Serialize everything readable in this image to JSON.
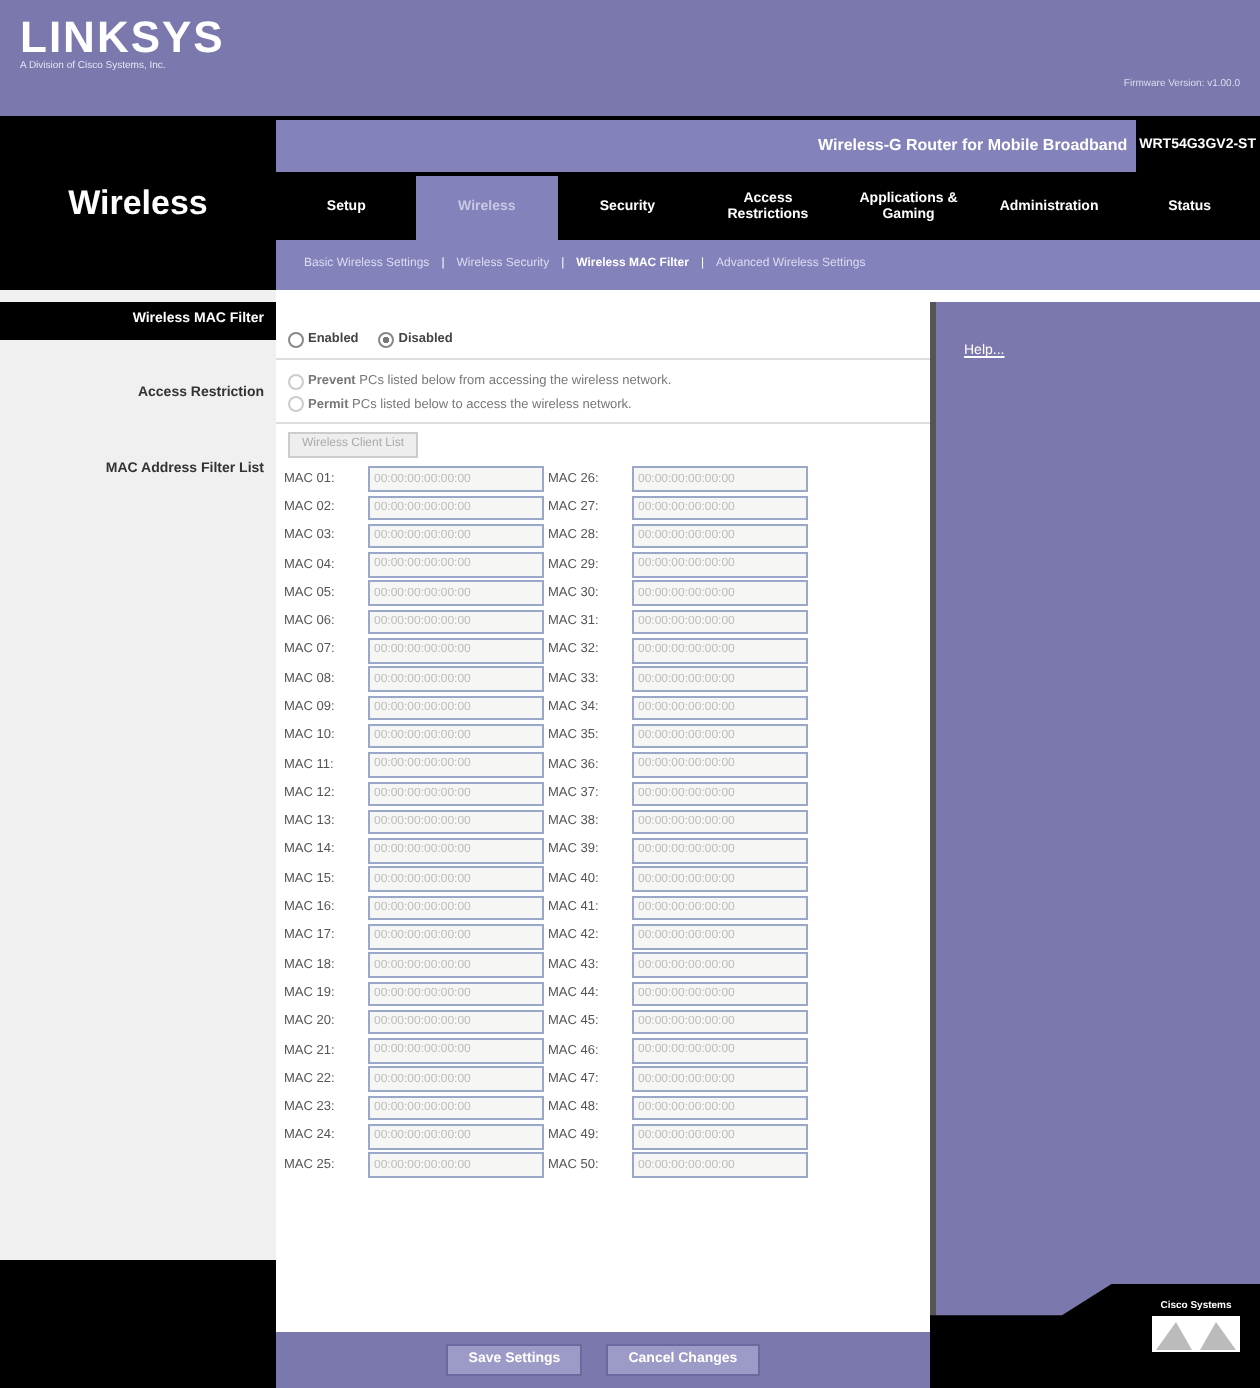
{
  "header": {
    "brand": "LINKSYS",
    "tagline": "A Division of Cisco Systems, Inc.",
    "firmware": "Firmware Version: v1.00.0"
  },
  "product": {
    "name": "Wireless-G Router for Mobile Broadband",
    "model": "WRT54G3GV2-ST"
  },
  "section_title": "Wireless",
  "tabs": [
    {
      "label": "Setup",
      "selected": false
    },
    {
      "label": "Wireless",
      "selected": true
    },
    {
      "label": "Security",
      "selected": false
    },
    {
      "label": "Access Restrictions",
      "selected": false
    },
    {
      "label": "Applications & Gaming",
      "selected": false
    },
    {
      "label": "Administration",
      "selected": false
    },
    {
      "label": "Status",
      "selected": false
    }
  ],
  "subtabs": [
    {
      "label": "Basic Wireless Settings",
      "selected": false
    },
    {
      "label": "Wireless Security",
      "selected": false
    },
    {
      "label": "Wireless MAC Filter",
      "selected": true
    },
    {
      "label": "Advanced Wireless Settings",
      "selected": false
    }
  ],
  "subtab_separator": "|",
  "labels": {
    "filter": "Wireless MAC Filter",
    "restriction": "Access Restriction",
    "list": "MAC Address Filter List"
  },
  "filter_options": [
    {
      "label": "Enabled",
      "selected": false
    },
    {
      "label": "Disabled",
      "selected": true
    }
  ],
  "restriction_options": [
    {
      "bold": "Prevent",
      "text": "PCs listed below from accessing the wireless network.",
      "selected": false,
      "disabled": true
    },
    {
      "bold": "Permit",
      "text": "PCs listed below to access the wireless network.",
      "selected": false,
      "disabled": true
    }
  ],
  "client_list_button": {
    "label": "Wireless Client List",
    "disabled": true
  },
  "mac_fields": [
    {
      "label": "MAC 01:",
      "value": "00:00:00:00:00:00",
      "disabled": true
    },
    {
      "label": "MAC 02:",
      "value": "00:00:00:00:00:00",
      "disabled": true
    },
    {
      "label": "MAC 03:",
      "value": "00:00:00:00:00:00",
      "disabled": true
    },
    {
      "label": "MAC 04:",
      "value": "00:00:00:00:00:00",
      "disabled": true
    },
    {
      "label": "MAC 05:",
      "value": "00:00:00:00:00:00",
      "disabled": true
    },
    {
      "label": "MAC 06:",
      "value": "00:00:00:00:00:00",
      "disabled": true
    },
    {
      "label": "MAC 07:",
      "value": "00:00:00:00:00:00",
      "disabled": true
    },
    {
      "label": "MAC 08:",
      "value": "00:00:00:00:00:00",
      "disabled": true
    },
    {
      "label": "MAC 09:",
      "value": "00:00:00:00:00:00",
      "disabled": true
    },
    {
      "label": "MAC 10:",
      "value": "00:00:00:00:00:00",
      "disabled": true
    },
    {
      "label": "MAC 11:",
      "value": "00:00:00:00:00:00",
      "disabled": true
    },
    {
      "label": "MAC 12:",
      "value": "00:00:00:00:00:00",
      "disabled": true
    },
    {
      "label": "MAC 13:",
      "value": "00:00:00:00:00:00",
      "disabled": true
    },
    {
      "label": "MAC 14:",
      "value": "00:00:00:00:00:00",
      "disabled": true
    },
    {
      "label": "MAC 15:",
      "value": "00:00:00:00:00:00",
      "disabled": true
    },
    {
      "label": "MAC 16:",
      "value": "00:00:00:00:00:00",
      "disabled": true
    },
    {
      "label": "MAC 17:",
      "value": "00:00:00:00:00:00",
      "disabled": true
    },
    {
      "label": "MAC 18:",
      "value": "00:00:00:00:00:00",
      "disabled": true
    },
    {
      "label": "MAC 19:",
      "value": "00:00:00:00:00:00",
      "disabled": true
    },
    {
      "label": "MAC 20:",
      "value": "00:00:00:00:00:00",
      "disabled": true
    },
    {
      "label": "MAC 21:",
      "value": "00:00:00:00:00:00",
      "disabled": true
    },
    {
      "label": "MAC 22:",
      "value": "00:00:00:00:00:00",
      "disabled": true
    },
    {
      "label": "MAC 23:",
      "value": "00:00:00:00:00:00",
      "disabled": true
    },
    {
      "label": "MAC 24:",
      "value": "00:00:00:00:00:00",
      "disabled": true
    },
    {
      "label": "MAC 25:",
      "value": "00:00:00:00:00:00",
      "disabled": true
    },
    {
      "label": "MAC 26:",
      "value": "00:00:00:00:00:00",
      "disabled": true
    },
    {
      "label": "MAC 27:",
      "value": "00:00:00:00:00:00",
      "disabled": true
    },
    {
      "label": "MAC 28:",
      "value": "00:00:00:00:00:00",
      "disabled": true
    },
    {
      "label": "MAC 29:",
      "value": "00:00:00:00:00:00",
      "disabled": true
    },
    {
      "label": "MAC 30:",
      "value": "00:00:00:00:00:00",
      "disabled": true
    },
    {
      "label": "MAC 31:",
      "value": "00:00:00:00:00:00",
      "disabled": true
    },
    {
      "label": "MAC 32:",
      "value": "00:00:00:00:00:00",
      "disabled": true
    },
    {
      "label": "MAC 33:",
      "value": "00:00:00:00:00:00",
      "disabled": true
    },
    {
      "label": "MAC 34:",
      "value": "00:00:00:00:00:00",
      "disabled": true
    },
    {
      "label": "MAC 35:",
      "value": "00:00:00:00:00:00",
      "disabled": true
    },
    {
      "label": "MAC 36:",
      "value": "00:00:00:00:00:00",
      "disabled": true
    },
    {
      "label": "MAC 37:",
      "value": "00:00:00:00:00:00",
      "disabled": true
    },
    {
      "label": "MAC 38:",
      "value": "00:00:00:00:00:00",
      "disabled": true
    },
    {
      "label": "MAC 39:",
      "value": "00:00:00:00:00:00",
      "disabled": true
    },
    {
      "label": "MAC 40:",
      "value": "00:00:00:00:00:00",
      "disabled": true
    },
    {
      "label": "MAC 41:",
      "value": "00:00:00:00:00:00",
      "disabled": true
    },
    {
      "label": "MAC 42:",
      "value": "00:00:00:00:00:00",
      "disabled": true
    },
    {
      "label": "MAC 43:",
      "value": "00:00:00:00:00:00",
      "disabled": true
    },
    {
      "label": "MAC 44:",
      "value": "00:00:00:00:00:00",
      "disabled": true
    },
    {
      "label": "MAC 45:",
      "value": "00:00:00:00:00:00",
      "disabled": true
    },
    {
      "label": "MAC 46:",
      "value": "00:00:00:00:00:00",
      "disabled": true
    },
    {
      "label": "MAC 47:",
      "value": "00:00:00:00:00:00",
      "disabled": true
    },
    {
      "label": "MAC 48:",
      "value": "00:00:00:00:00:00",
      "disabled": true
    },
    {
      "label": "MAC 49:",
      "value": "00:00:00:00:00:00",
      "disabled": true
    },
    {
      "label": "MAC 50:",
      "value": "00:00:00:00:00:00",
      "disabled": true
    }
  ],
  "help_link": "Help...",
  "buttons": [
    "Save Settings",
    "Cancel Changes"
  ],
  "footer_logo": "Cisco Systems"
}
